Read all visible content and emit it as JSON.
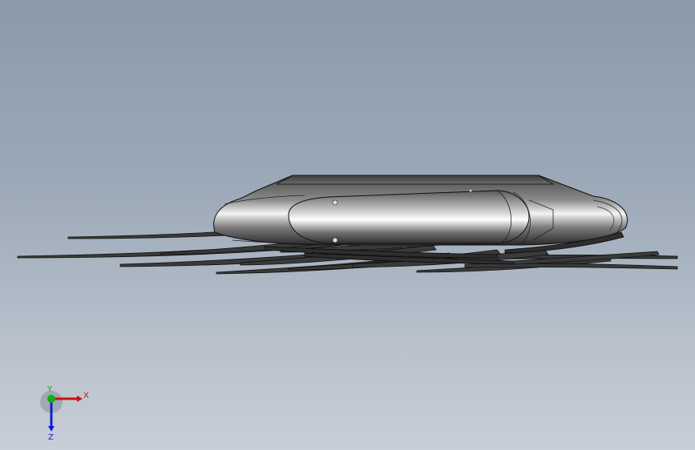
{
  "viewport": {
    "background_top": "#8b9aab",
    "background_bottom": "#c8ced7"
  },
  "model": {
    "body_color": "#6a6a6a",
    "edge_color": "#1a1a1a"
  },
  "triad": {
    "x_label": "X",
    "y_label": "Y",
    "z_label": "Z",
    "x_color": "#d01010",
    "y_color": "#10b010",
    "z_color": "#1020d0"
  }
}
